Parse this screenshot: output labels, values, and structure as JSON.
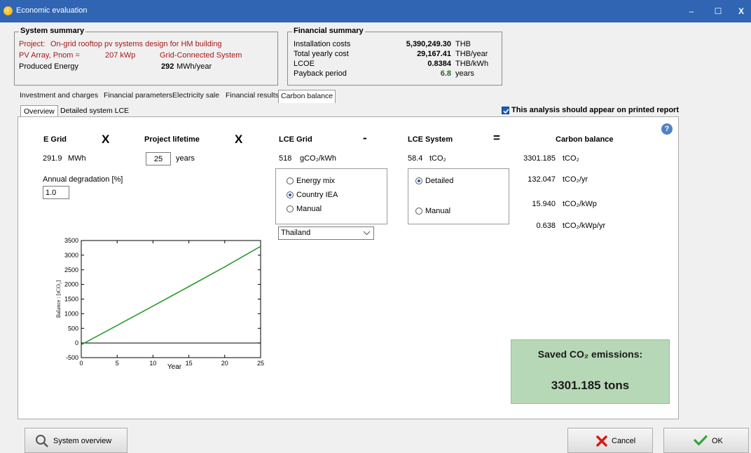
{
  "window": {
    "title": "Economic evaluation",
    "minimize": "–",
    "maximize": "☐",
    "close": "X"
  },
  "system_summary": {
    "legend": "System summary",
    "project_label": "Project:",
    "project_value": "On-grid rooftop pv systems design for HM building",
    "pv_label": "PV Array, Pnom =",
    "pv_value": "207 kWp",
    "grid_type": "Grid-Connected System",
    "energy_label": "Produced Energy",
    "energy_value": "292",
    "energy_unit": "MWh/year"
  },
  "financial_summary": {
    "legend": "Financial summary",
    "rows": [
      {
        "label": "Installation costs",
        "value": "5,390,249.30",
        "unit": "THB"
      },
      {
        "label": "Total yearly cost",
        "value": "29,167.41",
        "unit": "THB/year"
      },
      {
        "label": "LCOE",
        "value": "0.8384",
        "unit": "THB/kWh"
      },
      {
        "label": "Payback period",
        "value": "6.8",
        "unit": "years"
      }
    ]
  },
  "tabs": [
    "Investment and charges",
    "Financial parameters",
    "Electricity sale",
    "Financial results",
    "Carbon balance"
  ],
  "subtabs": [
    "Overview",
    "Detailed system LCE"
  ],
  "print_check_label": "This analysis should appear on printed report",
  "overview": {
    "egrid_header": "E Grid",
    "egrid_value": "291.9",
    "egrid_unit": "MWh",
    "lifetime_header": "Project lifetime",
    "lifetime_value": "25",
    "lifetime_unit": "years",
    "degradation_label": "Annual degradation [%]",
    "degradation_value": "1.0",
    "lce_grid_header": "LCE Grid",
    "lce_grid_value": "518",
    "lce_grid_unit": "gCO₂/kWh",
    "grid_options": [
      "Energy mix",
      "Country IEA",
      "Manual"
    ],
    "country": "Thailand",
    "lce_system_header": "LCE System",
    "lce_system_value": "58.4",
    "lce_system_unit": "tCO₂",
    "system_options": [
      "Detailed",
      "Manual"
    ],
    "carbon_header": "Carbon balance",
    "carbon_rows": [
      {
        "value": "3301.185",
        "unit": "tCO₂"
      },
      {
        "value": "132.047",
        "unit": "tCO₂/yr"
      },
      {
        "value": "15.940",
        "unit": "tCO₂/kWp"
      },
      {
        "value": "0.638",
        "unit": "tCO₂/kWp/yr"
      }
    ],
    "op_x1": "X",
    "op_x2": "X",
    "op_minus": "-",
    "op_equals": "=",
    "saved_title": "Saved CO₂ emissions:",
    "saved_value": "3301.185 tons"
  },
  "buttons": {
    "system_overview": "System overview",
    "cancel": "Cancel",
    "ok": "OK"
  },
  "chart_data": {
    "type": "line",
    "xlabel": "Year",
    "ylabel": "Balance : [tCO₂]",
    "xlim": [
      0,
      25
    ],
    "ylim": [
      -500,
      3500
    ],
    "xticks": [
      0,
      5,
      10,
      15,
      20,
      25
    ],
    "yticks": [
      -500,
      0,
      500,
      1000,
      1500,
      2000,
      2500,
      3000,
      3500
    ],
    "x": [
      0,
      5,
      10,
      15,
      20,
      25
    ],
    "y": [
      -58,
      600,
      1262,
      1928,
      2600,
      3301
    ],
    "line_color": "#2a9a2a",
    "zero_line": true
  },
  "colors": {
    "titlebar": "#2f65b3",
    "saved_bg": "#b7d8b7",
    "accent_red": "#a81818",
    "check_blue": "#1e5fb5",
    "line_green": "#2a9a2a"
  }
}
